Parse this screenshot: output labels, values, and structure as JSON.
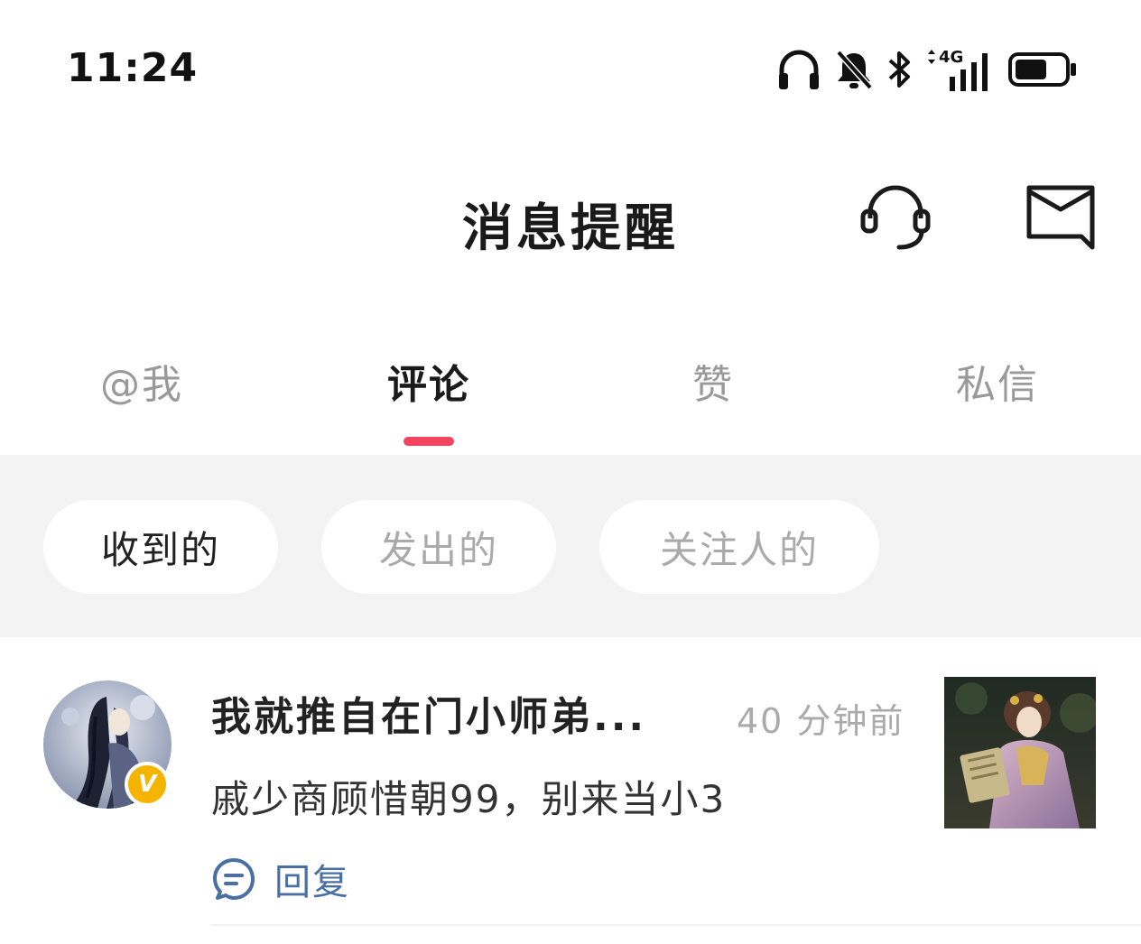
{
  "status_bar": {
    "time": "11:24",
    "network": "4G",
    "icons": [
      "headphones-icon",
      "bell-off-icon",
      "bluetooth-icon",
      "signal-icon",
      "battery-icon"
    ]
  },
  "header": {
    "title": "消息提醒",
    "support_icon": "headset-icon",
    "mail_icon": "mail-icon"
  },
  "tabs": [
    {
      "label": "@我",
      "active": false
    },
    {
      "label": "评论",
      "active": true
    },
    {
      "label": "赞",
      "active": false
    },
    {
      "label": "私信",
      "active": false
    }
  ],
  "filters": [
    {
      "label": "收到的",
      "active": true
    },
    {
      "label": "发出的",
      "active": false
    },
    {
      "label": "关注人的",
      "active": false
    }
  ],
  "messages": [
    {
      "name": "我就推自在门小师弟...",
      "time": "40 分钟前",
      "text": "戚少商顾惜朝99，别来当小3",
      "verified_badge": "V",
      "reply_label": "回复",
      "reply_icon": "comment-bubble-icon"
    }
  ],
  "colors": {
    "accent": "#f2445e",
    "badge": "#f5b400",
    "reply": "#4a6fa5",
    "filter_bg": "#f3f3f3"
  }
}
